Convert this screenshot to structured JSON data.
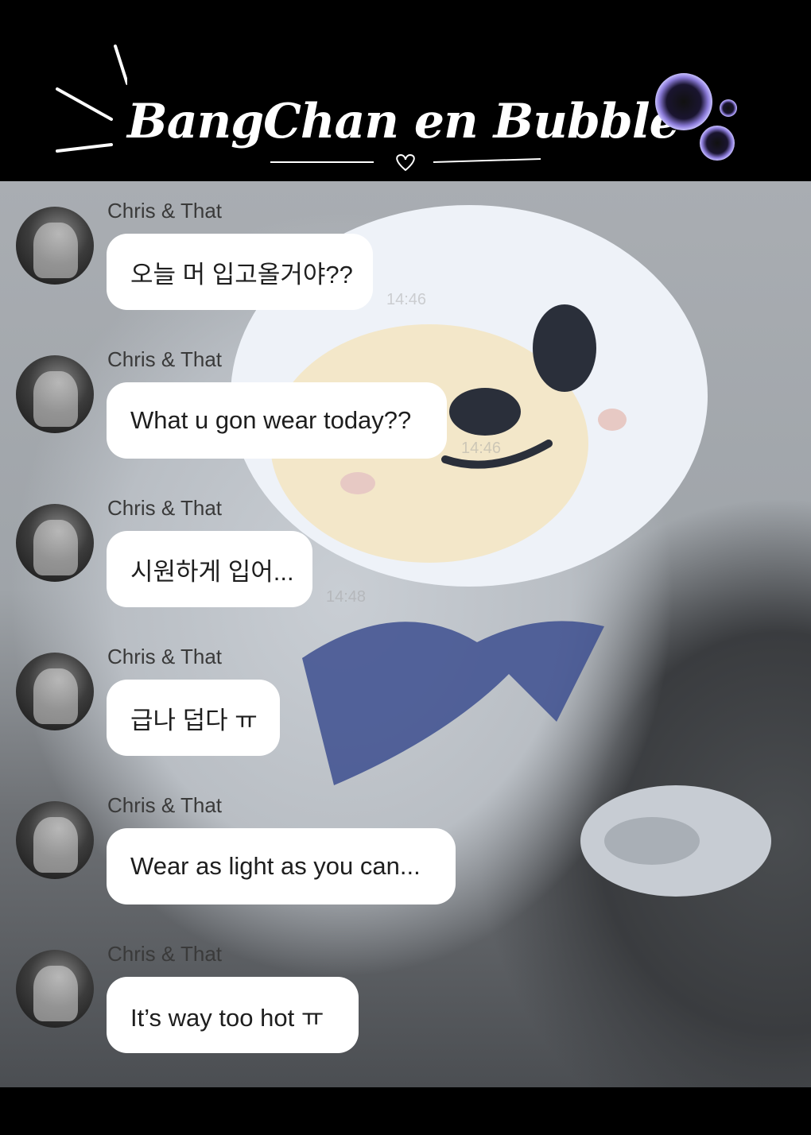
{
  "header": {
    "title": "BangChan en Bubble"
  },
  "messages": [
    {
      "sender": "Chris & That",
      "text": "오늘 머 입고올거야??",
      "time": "14:46"
    },
    {
      "sender": "Chris & That",
      "text": "What u gon wear today??",
      "time": "14:46"
    },
    {
      "sender": "Chris & That",
      "text": "시원하게 입어...",
      "time": "14:48"
    },
    {
      "sender": "Chris & That",
      "text": "급나 덥다 ㅠ",
      "time": ""
    },
    {
      "sender": "Chris & That",
      "text": "Wear as light as you can...",
      "time": ""
    },
    {
      "sender": "Chris & That",
      "text": "It’s way too hot ㅠ",
      "time": ""
    }
  ]
}
